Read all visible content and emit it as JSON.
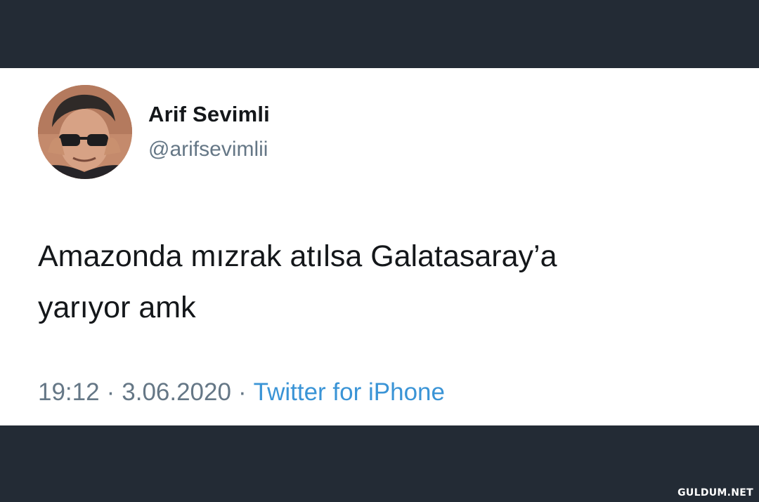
{
  "tweet": {
    "author": {
      "display_name": "Arif Sevimli",
      "handle": "@arifsevimlii"
    },
    "text_lines": [
      "Amazonda mızrak atılsa Galatasaray’a",
      "yarıyor amk"
    ],
    "time": "19:12",
    "date": "3.06.2020",
    "separator": "·",
    "source": "Twitter for iPhone"
  },
  "watermark": "GULDUM.NET",
  "colors": {
    "frame": "#232b35",
    "card": "#ffffff",
    "text": "#14171a",
    "secondary": "#657786",
    "link": "#3a94d6"
  }
}
